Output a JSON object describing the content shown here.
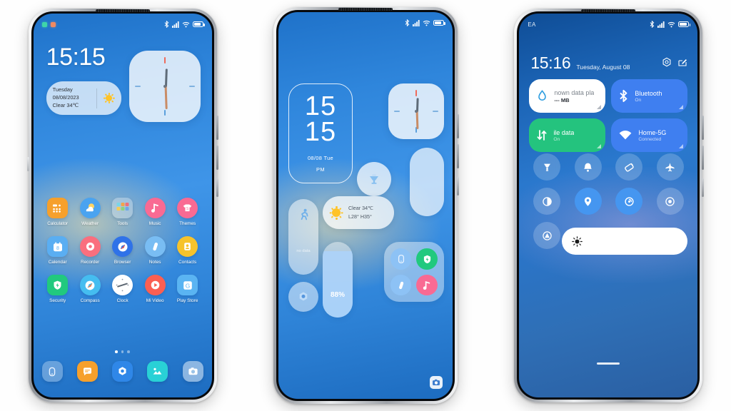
{
  "scene": {
    "background_color": "#ffffff",
    "device_count": 3,
    "description": "Three Xiaomi MIUI phone mockups showing home screen, widget page and control center"
  },
  "phone1": {
    "status_bar": {
      "indicator_dots": [
        "green-dot",
        "orange-dot"
      ],
      "icons": [
        "bluetooth-icon",
        "signal-icon",
        "wifi-icon",
        "battery-icon"
      ]
    },
    "clock": "15:15",
    "date_widget": {
      "weekday": "Tuesday",
      "date": "08/08/2023",
      "weather": "Clear 34℃",
      "icon": "sun-icon"
    },
    "analog_clock_widget": {
      "name": "analog-clock-widget",
      "hour_hand_deg": 272,
      "minute_hand_deg": 88
    },
    "apps": [
      [
        {
          "label": "Calculator",
          "icon": "calculator-icon",
          "bg": "#f6a02c",
          "shape": "squircle"
        },
        {
          "label": "Weather",
          "icon": "weather-icon",
          "bg": "#4aa3f0",
          "shape": "round"
        },
        {
          "label": "Tools",
          "icon": "tools-folder-icon",
          "bg": "rgba(255,255,255,0.30)",
          "shape": "squircle"
        },
        {
          "label": "Music",
          "icon": "music-note-icon",
          "bg": "#f96a93",
          "shape": "round"
        },
        {
          "label": "Themes",
          "icon": "themes-shirt-icon",
          "bg": "#f96a93",
          "shape": "round"
        }
      ],
      [
        {
          "label": "Calendar",
          "icon": "calendar-icon",
          "bg": "#5aaef2",
          "shape": "squircle"
        },
        {
          "label": "Recorder",
          "icon": "recorder-icon",
          "bg": "#fa6f7e",
          "shape": "round"
        },
        {
          "label": "Browser",
          "icon": "browser-compass-icon",
          "bg": "#2f72e8",
          "shape": "round"
        },
        {
          "label": "Notes",
          "icon": "notes-icon",
          "bg": "#79bdf3",
          "shape": "round"
        },
        {
          "label": "Contacts",
          "icon": "contacts-icon",
          "bg": "#f6c32c",
          "shape": "round"
        }
      ],
      [
        {
          "label": "Security",
          "icon": "security-shield-icon",
          "bg": "#21c97e",
          "shape": "squircle"
        },
        {
          "label": "Compass",
          "icon": "compass-icon",
          "bg": "#45bdf0",
          "shape": "round"
        },
        {
          "label": "Clock",
          "icon": "clock-icon",
          "bg": "#ffffff",
          "shape": "round"
        },
        {
          "label": "Mi Video",
          "icon": "video-play-icon",
          "bg": "#fb5f52",
          "shape": "round"
        },
        {
          "label": "Play Store",
          "icon": "play-store-icon",
          "bg": "#5ab4f2",
          "shape": "squircle"
        }
      ]
    ],
    "page_dots": {
      "count": 3,
      "active_index": 0
    },
    "dock": [
      {
        "name": "phone-dock-icon",
        "icon": "phone-icon",
        "bg": "rgba(255,255,255,0.30)"
      },
      {
        "name": "messages-dock-icon",
        "icon": "message-icon",
        "bg": "#f6a02c"
      },
      {
        "name": "settings-dock-icon",
        "icon": "settings-gear-icon",
        "bg": "#2f87e8"
      },
      {
        "name": "gallery-dock-icon",
        "icon": "gallery-icon",
        "bg": "#29d1d6"
      },
      {
        "name": "camera-dock-icon",
        "icon": "camera-icon",
        "bg": "rgba(255,255,255,0.48)"
      }
    ]
  },
  "phone2": {
    "status_bar": {
      "icons": [
        "bluetooth-icon",
        "signal-icon",
        "wifi-icon",
        "battery-icon"
      ]
    },
    "big_clock_widget": {
      "hours": "15",
      "minutes": "15",
      "date": "08/08 Tue",
      "meridiem": "PM"
    },
    "analog_clock_widget": {
      "name": "analog-clock-widget"
    },
    "lamp_widget": {
      "icon": "lamp-icon"
    },
    "steps_widget": {
      "icon": "running-person-icon",
      "value": "no data"
    },
    "weather_widget": {
      "icon": "sun-icon",
      "condition": "Clear 34℃",
      "range": "L28° H35°"
    },
    "battery_widget": {
      "percent": "88%",
      "fill": 88
    },
    "folder_widget": {
      "apps": [
        {
          "name": "phone-folder-icon",
          "icon": "phone-icon",
          "bg": "#8dc2f5"
        },
        {
          "name": "security-folder-icon",
          "icon": "security-shield-icon",
          "bg": "#21c97e"
        },
        {
          "name": "notes-folder-icon",
          "icon": "notes-icon",
          "bg": "#8dc2f5"
        },
        {
          "name": "music-folder-icon",
          "icon": "music-note-icon",
          "bg": "#f96a93"
        }
      ]
    },
    "settings_shortcut": {
      "icon": "settings-gear-icon"
    },
    "camera_shortcut": {
      "icon": "camera-icon"
    }
  },
  "phone3": {
    "status_bar": {
      "carrier": "EA",
      "icons": [
        "bluetooth-icon",
        "signal-icon",
        "wifi-icon",
        "battery-icon"
      ]
    },
    "header": {
      "time": "15:16",
      "date": "Tuesday, August 08",
      "settings_icon": "settings-gear-icon",
      "edit_icon": "edit-pencil-icon"
    },
    "tiles": [
      {
        "name": "data-usage-tile",
        "title": "nown data pla",
        "subtitle": "--- MB",
        "icon": "data-drop-icon",
        "style": "white",
        "state": "off"
      },
      {
        "name": "bluetooth-tile",
        "title": "Bluetooth",
        "subtitle": "On",
        "icon": "bluetooth-icon",
        "style": "blue",
        "state": "on"
      },
      {
        "name": "mobile-data-tile",
        "title": "ile data",
        "subtitle": "On",
        "icon": "mobile-data-icon",
        "style": "green",
        "state": "on"
      },
      {
        "name": "wifi-tile",
        "title": "Home-5G",
        "subtitle": "Connected",
        "icon": "wifi-icon",
        "style": "blue",
        "state": "on"
      }
    ],
    "toggles": [
      {
        "name": "flashlight-toggle",
        "icon": "flashlight-icon",
        "on": false
      },
      {
        "name": "silent-toggle",
        "icon": "bell-icon",
        "on": false
      },
      {
        "name": "auto-rotate-toggle",
        "icon": "rotate-icon",
        "on": false
      },
      {
        "name": "airplane-toggle",
        "icon": "airplane-icon",
        "on": false
      },
      {
        "name": "dark-mode-toggle",
        "icon": "contrast-icon",
        "on": false
      },
      {
        "name": "location-toggle",
        "icon": "location-pin-icon",
        "on": true
      },
      {
        "name": "cast-toggle",
        "icon": "cast-icon",
        "on": true
      },
      {
        "name": "screen-record-toggle",
        "icon": "record-icon",
        "on": false
      },
      {
        "name": "vpn-toggle",
        "icon": "triangle-up-icon",
        "on": false
      }
    ],
    "brightness_slider": {
      "name": "brightness-slider",
      "icon": "brightness-sun-icon",
      "value": 100
    },
    "home_indicator": true
  },
  "colors": {
    "wallpaper_blue": "#2f86dc",
    "accent_blue": "#3f7ff0",
    "accent_green": "#24c37e",
    "tile_white": "#ffffff"
  }
}
